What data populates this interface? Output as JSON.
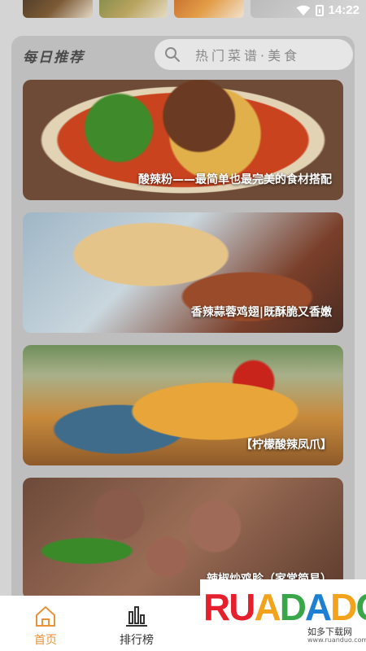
{
  "status_bar": {
    "time": "14:22"
  },
  "recommend": {
    "title": "每日推荐",
    "search_placeholder": "热门菜谱·美食"
  },
  "recipes": [
    {
      "caption": "酸辣粉——最简单也最完美的食材搭配"
    },
    {
      "caption": "香辣蒜蓉鸡翅|既酥脆又香嫩"
    },
    {
      "caption": "【柠檬酸辣凤爪】"
    },
    {
      "caption": "辣椒炒鸡胗（家常简易）"
    }
  ],
  "bottom_nav": {
    "items": [
      {
        "label": "首页",
        "icon": "home-icon",
        "active": true
      },
      {
        "label": "排行榜",
        "icon": "rank-chart-icon",
        "active": false
      }
    ]
  },
  "colors": {
    "accent": "#e8923a",
    "background": "#d4d4d4",
    "card": "#bebebe"
  },
  "watermark": {
    "logo": "RUANDAOO",
    "subtitle": "如多下载网",
    "url": "www.ruanduo.com"
  }
}
